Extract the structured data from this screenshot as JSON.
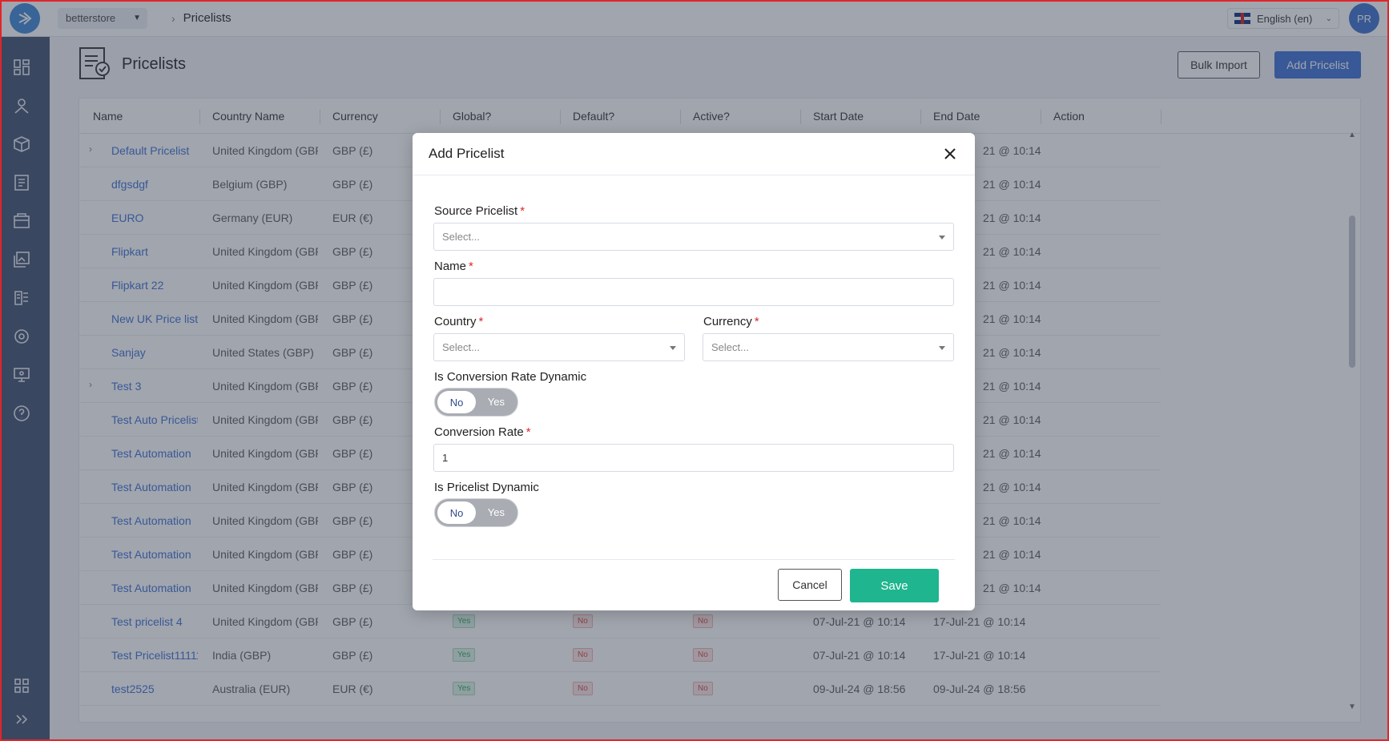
{
  "topbar": {
    "store": "betterstore",
    "breadcrumb": "Pricelists",
    "language": "English (en)",
    "avatar_initials": "PR"
  },
  "sidebar": {
    "icons": [
      "dashboard-icon",
      "catalog-icon",
      "product-box-icon",
      "orders-icon",
      "inventory-icon",
      "media-icon",
      "pricelist-icon",
      "settings-icon",
      "display-icon",
      "help-icon",
      "apps-grid-icon",
      "expand-icon"
    ]
  },
  "page": {
    "title": "Pricelists",
    "bulk_import_label": "Bulk Import",
    "add_pricelist_label": "Add Pricelist"
  },
  "table": {
    "columns": [
      "Name",
      "Country Name",
      "Currency",
      "Global?",
      "Default?",
      "Active?",
      "Start Date",
      "End Date",
      "Action"
    ],
    "rows": [
      {
        "name": "Default Pricelist",
        "country": "United Kingdom (GBP)",
        "currency": "GBP (£)",
        "end": "21 @ 10:14",
        "expand": true
      },
      {
        "name": "dfgsdgf",
        "country": "Belgium (GBP)",
        "currency": "GBP (£)",
        "end": "21 @ 10:14"
      },
      {
        "name": "EURO",
        "country": "Germany (EUR)",
        "currency": "EUR (€)",
        "end": "21 @ 10:14"
      },
      {
        "name": "Flipkart",
        "country": "United Kingdom (GBP)",
        "currency": "GBP (£)",
        "end": "21 @ 10:14"
      },
      {
        "name": "Flipkart 22",
        "country": "United Kingdom (GBP)",
        "currency": "GBP (£)",
        "end": "21 @ 10:14"
      },
      {
        "name": "New UK Price list",
        "country": "United Kingdom (GBP)",
        "currency": "GBP (£)",
        "end": "21 @ 10:14"
      },
      {
        "name": "Sanjay",
        "country": "United States (GBP)",
        "currency": "GBP (£)",
        "end": "21 @ 10:14"
      },
      {
        "name": "Test 3",
        "country": "United Kingdom (GBP)",
        "currency": "GBP (£)",
        "end": "21 @ 10:14",
        "expand": true
      },
      {
        "name": "Test Auto Pricelist",
        "country": "United Kingdom (GBP)",
        "currency": "GBP (£)",
        "end": "21 @ 10:14"
      },
      {
        "name": "Test Automation",
        "country": "United Kingdom (GBP)",
        "currency": "GBP (£)",
        "end": "21 @ 10:14"
      },
      {
        "name": "Test Automation",
        "country": "United Kingdom (GBP)",
        "currency": "GBP (£)",
        "end": "21 @ 10:14"
      },
      {
        "name": "Test Automation",
        "country": "United Kingdom (GBP)",
        "currency": "GBP (£)",
        "end": "21 @ 10:14"
      },
      {
        "name": "Test Automation",
        "country": "United Kingdom (GBP)",
        "currency": "GBP (£)",
        "end": "21 @ 10:14"
      },
      {
        "name": "Test Automation",
        "country": "United Kingdom (GBP)",
        "currency": "GBP (£)",
        "end": "21 @ 10:14"
      },
      {
        "name": "Test pricelist 4",
        "country": "United Kingdom (GBP)",
        "currency": "GBP (£)",
        "global": "Yes",
        "default": "No",
        "active": "No",
        "start": "07-Jul-21 @ 10:14",
        "end": "17-Jul-21 @ 10:14"
      },
      {
        "name": "Test Pricelist11111",
        "country": "India (GBP)",
        "currency": "GBP (£)",
        "global": "Yes",
        "default": "No",
        "active": "No",
        "start": "07-Jul-21 @ 10:14",
        "end": "17-Jul-21 @ 10:14"
      },
      {
        "name": "test2525",
        "country": "Australia (EUR)",
        "currency": "EUR (€)",
        "global": "Yes",
        "default": "No",
        "active": "No",
        "start": "09-Jul-24 @ 18:56",
        "end": "09-Jul-24 @ 18:56"
      }
    ]
  },
  "modal": {
    "title": "Add Pricelist",
    "source_label": "Source Pricelist",
    "source_placeholder": "Select...",
    "name_label": "Name",
    "name_value": "",
    "country_label": "Country",
    "country_placeholder": "Select...",
    "currency_label": "Currency",
    "currency_placeholder": "Select...",
    "conv_dynamic_label": "Is Conversion Rate Dynamic",
    "conv_rate_label": "Conversion Rate",
    "conv_rate_value": "1",
    "pricelist_dynamic_label": "Is Pricelist Dynamic",
    "toggle_no": "No",
    "toggle_yes": "Yes",
    "required_mark": "*",
    "cancel_label": "Cancel",
    "save_label": "Save"
  }
}
